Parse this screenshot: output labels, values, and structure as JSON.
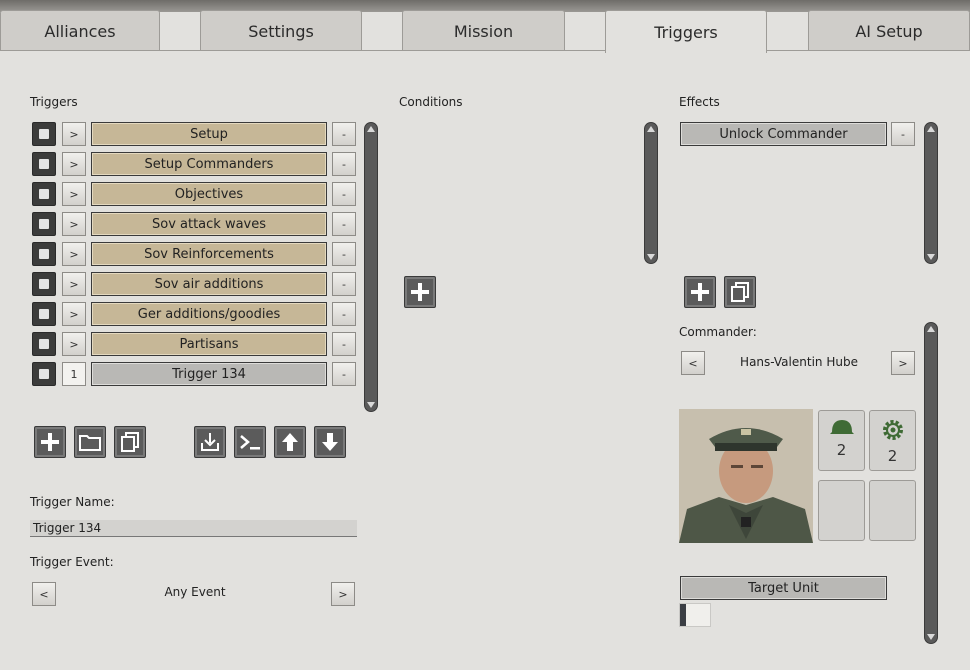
{
  "tabs": [
    {
      "label": "Alliances"
    },
    {
      "label": "Settings"
    },
    {
      "label": "Mission"
    },
    {
      "label": "Triggers",
      "active": true
    },
    {
      "label": "AI Setup"
    }
  ],
  "triggers": {
    "heading": "Triggers",
    "rows": [
      {
        "label": "Setup",
        "prefix": ">"
      },
      {
        "label": "Setup Commanders",
        "prefix": ">"
      },
      {
        "label": "Objectives",
        "prefix": ">"
      },
      {
        "label": "Sov attack waves",
        "prefix": ">"
      },
      {
        "label": "Sov Reinforcements",
        "prefix": ">"
      },
      {
        "label": "Sov air additions",
        "prefix": ">"
      },
      {
        "label": "Ger additions/goodies",
        "prefix": ">"
      },
      {
        "label": "Partisans",
        "prefix": ">"
      },
      {
        "label": "Trigger 134",
        "prefix": "1"
      }
    ],
    "remove_label": "-",
    "name_label": "Trigger Name:",
    "name_value": "Trigger 134",
    "event_label": "Trigger Event:",
    "event_value": "Any Event",
    "prev": "<",
    "next": ">"
  },
  "conditions": {
    "heading": "Conditions"
  },
  "effects": {
    "heading": "Effects",
    "items": [
      {
        "label": "Unlock Commander"
      }
    ],
    "remove_label": "-"
  },
  "commander": {
    "label": "Commander:",
    "name": "Hans-Valentin Hube",
    "prev": "<",
    "next": ">",
    "skills": [
      {
        "icon": "helmet-icon",
        "value": "2"
      },
      {
        "icon": "gear-icon",
        "value": "2"
      }
    ],
    "target_label": "Target Unit"
  },
  "colors": {
    "background": "#e2e1de",
    "trigger_row": "#c6b797",
    "selected_row": "#b9b8b5",
    "icon_button": "#5b5b5b"
  }
}
